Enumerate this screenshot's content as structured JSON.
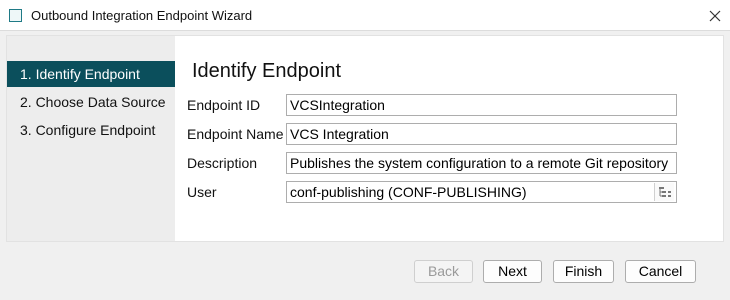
{
  "window": {
    "title": "Outbound Integration Endpoint Wizard",
    "close_icon": "close-icon",
    "app_icon": "window-icon"
  },
  "steps": [
    {
      "label": "1. Identify Endpoint",
      "active": true
    },
    {
      "label": "2. Choose Data Source",
      "active": false
    },
    {
      "label": "3. Configure Endpoint",
      "active": false
    }
  ],
  "page": {
    "heading": "Identify Endpoint"
  },
  "form": {
    "endpoint_id": {
      "label": "Endpoint ID",
      "value": "VCSIntegration"
    },
    "endpoint_name": {
      "label": "Endpoint Name",
      "value": "VCS Integration"
    },
    "description": {
      "label": "Description",
      "value": "Publishes the system configuration to a remote Git repository"
    },
    "user": {
      "label": "User",
      "value": "conf-publishing (CONF-PUBLISHING)",
      "lookup_icon": "lookup-icon"
    }
  },
  "buttons": {
    "back": {
      "label": "Back",
      "enabled": false
    },
    "next": {
      "label": "Next",
      "enabled": true
    },
    "finish": {
      "label": "Finish",
      "enabled": true
    },
    "cancel": {
      "label": "Cancel",
      "enabled": true
    }
  },
  "colors": {
    "active_step_bg": "#0b4f5c",
    "steps_bg": "#ededed",
    "dialog_bg": "#f0f0f0"
  }
}
